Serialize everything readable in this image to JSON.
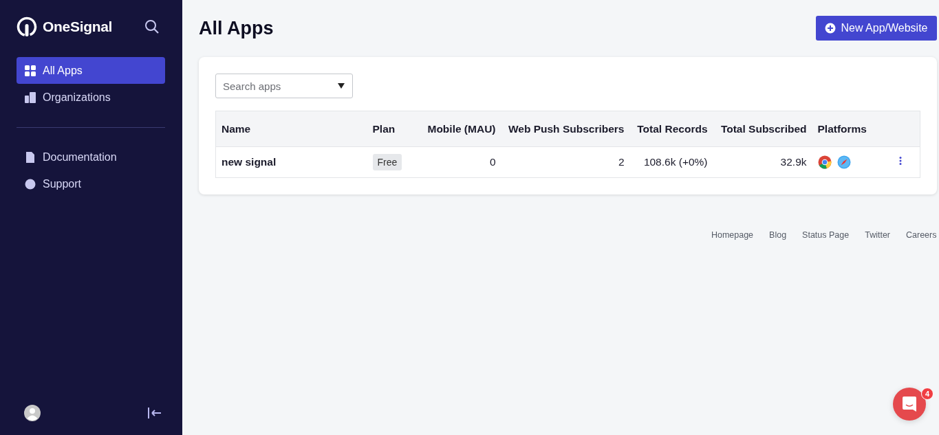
{
  "sidebar": {
    "brand": "OneSignal",
    "nav": [
      {
        "label": "All Apps",
        "selected": true
      },
      {
        "label": "Organizations",
        "selected": false
      }
    ],
    "links": [
      {
        "label": "Documentation"
      },
      {
        "label": "Support"
      }
    ]
  },
  "header": {
    "title": "All Apps",
    "action": "New App/Website"
  },
  "search": {
    "placeholder": "Search apps"
  },
  "table": {
    "columns": [
      "Name",
      "Plan",
      "Mobile (MAU)",
      "Web Push Subscribers",
      "Total Records",
      "Total Subscribed",
      "Platforms"
    ],
    "rows": [
      {
        "name": "new signal",
        "plan": "Free",
        "mobile": "0",
        "web_push": "2",
        "records": "108.6k (+0%)",
        "subscribed": "32.9k",
        "platforms": [
          {
            "kind": "chrome"
          },
          {
            "kind": "safari"
          }
        ]
      }
    ]
  },
  "footer": [
    "Homepage",
    "Blog",
    "Status Page",
    "Twitter",
    "Careers"
  ],
  "chat": {
    "badge": "4"
  }
}
